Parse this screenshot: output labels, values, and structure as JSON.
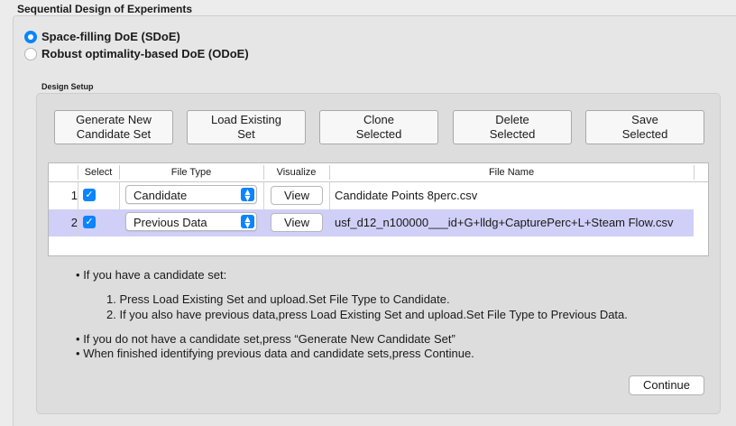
{
  "panel": {
    "title": "Sequential Design of Experiments"
  },
  "modes": [
    {
      "label": "Space-filling DoE (SDoE)",
      "selected": true
    },
    {
      "label": "Robust optimality-based DoE (ODoE)",
      "selected": false
    }
  ],
  "design_setup": {
    "title": "Design Setup",
    "buttons": [
      {
        "label": "Generate New\nCandidate Set"
      },
      {
        "label": "Load Existing\nSet"
      },
      {
        "label": "Clone\nSelected"
      },
      {
        "label": "Delete\nSelected"
      },
      {
        "label": "Save\nSelected"
      }
    ],
    "table": {
      "columns": [
        "Select",
        "File Type",
        "Visualize",
        "File Name"
      ],
      "rows": [
        {
          "num": "1",
          "checked": true,
          "file_type": "Candidate",
          "visualize": "View",
          "file_name": "Candidate Points 8perc.csv",
          "selected": false
        },
        {
          "num": "2",
          "checked": true,
          "file_type": "Previous Data",
          "visualize": "View",
          "file_name": "usf_d12_n100000___id+G+lldg+CapturePerc+L+Steam Flow.csv",
          "selected": true
        }
      ]
    },
    "instructions": {
      "bullet1": "If you have a candidate set:",
      "step1": "1. Press Load Existing Set and upload.Set File Type to Candidate.",
      "step2": "2. If you also have previous data,press Load Existing Set and upload.Set File Type to Previous Data.",
      "bullet2": "If you do not have a candidate set,press “Generate New Candidate Set”",
      "bullet3": "When finished identifying previous data and candidate sets,press Continue."
    },
    "continue_label": "Continue"
  },
  "colors": {
    "accent": "#0a84ff",
    "row_highlight": "#cfcff7"
  },
  "icons": {
    "checkbox": "checkmark-icon",
    "select": "chevron-updown-icon",
    "bullet": "bullet-icon"
  }
}
